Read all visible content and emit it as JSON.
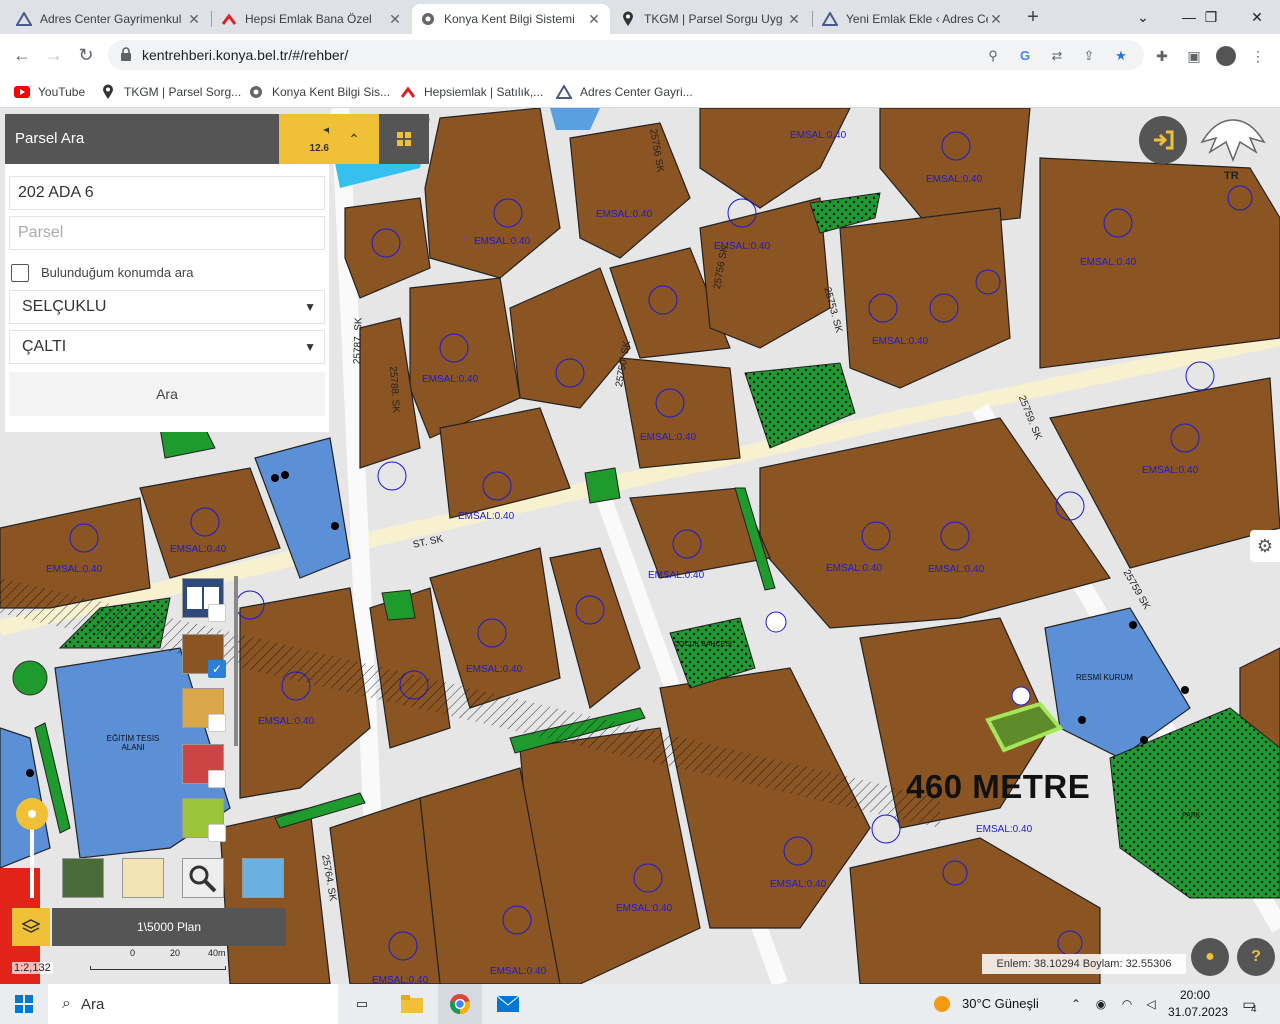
{
  "browser": {
    "tabs": [
      {
        "label": "Adres Center Gayrimenkul",
        "icon": "adres-center-icon",
        "active": false
      },
      {
        "label": "Hepsi Emlak Bana Özel",
        "icon": "hepsiemlak-icon",
        "active": false
      },
      {
        "label": "Konya Kent Bilgi Sistemi",
        "icon": "konya-icon",
        "active": true
      },
      {
        "label": "TKGM | Parsel Sorgu Uyg",
        "icon": "map-pin-icon",
        "active": false
      },
      {
        "label": "Yeni Emlak Ekle ‹ Adres Ce",
        "icon": "adres-center-icon",
        "active": false
      }
    ],
    "url": "kentrehberi.konya.bel.tr/#/rehber/",
    "bookmarks": [
      {
        "label": "YouTube",
        "icon": "youtube-icon"
      },
      {
        "label": "TKGM | Parsel Sorg...",
        "icon": "map-pin-icon"
      },
      {
        "label": "Konya Kent Bilgi Sis...",
        "icon": "konya-icon"
      },
      {
        "label": "Hepsiemlak | Satılık,...",
        "icon": "hepsiemlak-icon"
      },
      {
        "label": "Adres Center Gayri...",
        "icon": "adres-center-icon"
      }
    ]
  },
  "panel": {
    "title": "Parsel Ara",
    "distance": "12.609M",
    "ada_value": "202 ADA 6",
    "parsel_placeholder": "Parsel",
    "location_checkbox_label": "Bulunduğum konumda ara",
    "district": "SELÇUKLU",
    "neighborhood": "ÇALTI",
    "search_button": "Ara"
  },
  "map": {
    "measure_label": "460 METRE",
    "plan_label": "1\\5000 Plan",
    "scale_ratio": "1:2,132",
    "scale_ticks": [
      "0",
      "20",
      "40m"
    ],
    "coordinates": "Enlem: 38.10294 Boylam: 32.55306",
    "logo_text": "TR",
    "emsal_label": "EMSAL:0.40",
    "street_labels": [
      "25756 SK",
      "25750. SK",
      "25787. SK",
      "25788. SK",
      "25753. SK",
      "25759. SK",
      "25756 SK",
      "25759 SK",
      "25764. SK",
      "ST. SK"
    ],
    "area_labels": [
      "EĞİTİM TESİS ALANI",
      "RESMİ KURUM",
      "ÇOCUK BAHÇESİ",
      "PARK"
    ]
  },
  "taskbar": {
    "search_label": "Ara",
    "weather": "30°C  Güneşli",
    "time": "20:00",
    "date": "31.07.2023",
    "notifications": "4"
  }
}
